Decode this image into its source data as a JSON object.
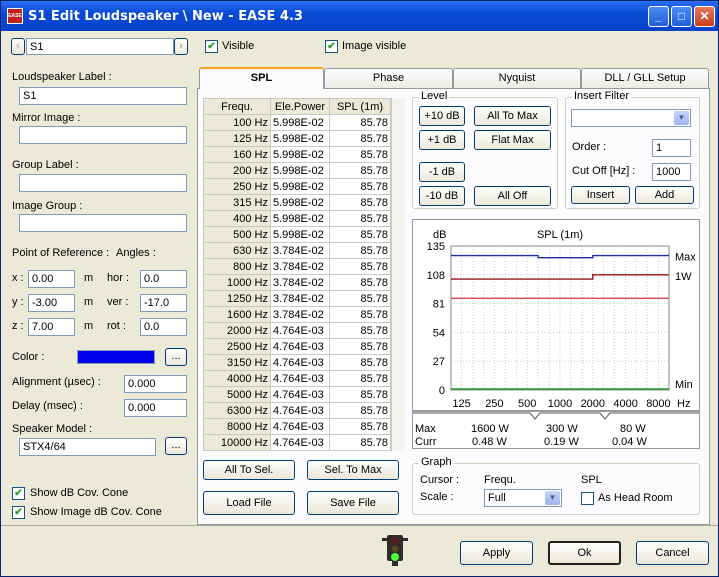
{
  "window": {
    "title": "S1 Edit Loudspeaker \\ New - EASE 4.3",
    "icon_text": "EASE",
    "buttons": {
      "minimize": "_",
      "maximize": "□",
      "close": "✕"
    }
  },
  "topbar": {
    "prev": "‹",
    "next": "›",
    "selector_value": "S1",
    "visible_label": "Visible",
    "visible_checked": true,
    "image_visible_label": "Image visible",
    "image_visible_checked": true
  },
  "left": {
    "loudspeaker_label_caption": "Loudspeaker Label :",
    "loudspeaker_label_value": "S1",
    "mirror_image_caption": "Mirror Image :",
    "mirror_image_value": "",
    "group_label_caption": "Group Label :",
    "group_label_value": "",
    "image_group_caption": "Image Group :",
    "image_group_value": "",
    "por_caption": "Point of Reference :",
    "angles_caption": "Angles :",
    "x_label": "x :",
    "x_value": "0.00",
    "x_unit": "m",
    "y_label": "y :",
    "y_value": "-3.00",
    "y_unit": "m",
    "z_label": "z :",
    "z_value": "7.00",
    "z_unit": "m",
    "hor_label": "hor :",
    "hor_value": "0.0",
    "ver_label": "ver :",
    "ver_value": "-17.0",
    "rot_label": "rot :",
    "rot_value": "0.0",
    "color_caption": "Color :",
    "color_value": "#0000ee",
    "ellipsis": "...",
    "alignment_caption": "Alignment (µsec) :",
    "alignment_value": "0.000",
    "delay_caption": "Delay (msec) :",
    "delay_value": "0.000",
    "speaker_model_caption": "Speaker Model :",
    "speaker_model_value": "STX4/64",
    "show_db_cov_label": "Show dB Cov. Cone",
    "show_db_cov_checked": true,
    "show_image_db_cov_label": "Show Image dB Cov. Cone",
    "show_image_db_cov_checked": true
  },
  "tabs": [
    "SPL",
    "Phase",
    "Nyquist",
    "DLL / GLL Setup"
  ],
  "table": {
    "headers": [
      "Frequ.",
      "Ele.Power",
      "SPL (1m)"
    ],
    "rows": [
      [
        "100 Hz",
        "5.998E-02",
        "85.78"
      ],
      [
        "125 Hz",
        "5.998E-02",
        "85.78"
      ],
      [
        "160 Hz",
        "5.998E-02",
        "85.78"
      ],
      [
        "200 Hz",
        "5.998E-02",
        "85.78"
      ],
      [
        "250 Hz",
        "5.998E-02",
        "85.78"
      ],
      [
        "315 Hz",
        "5.998E-02",
        "85.78"
      ],
      [
        "400 Hz",
        "5.998E-02",
        "85.78"
      ],
      [
        "500 Hz",
        "5.998E-02",
        "85.78"
      ],
      [
        "630 Hz",
        "3.784E-02",
        "85.78"
      ],
      [
        "800 Hz",
        "3.784E-02",
        "85.78"
      ],
      [
        "1000 Hz",
        "3.784E-02",
        "85.78"
      ],
      [
        "1250 Hz",
        "3.784E-02",
        "85.78"
      ],
      [
        "1600 Hz",
        "3.784E-02",
        "85.78"
      ],
      [
        "2000 Hz",
        "4.764E-03",
        "85.78"
      ],
      [
        "2500 Hz",
        "4.764E-03",
        "85.78"
      ],
      [
        "3150 Hz",
        "4.764E-03",
        "85.78"
      ],
      [
        "4000 Hz",
        "4.764E-03",
        "85.78"
      ],
      [
        "5000 Hz",
        "4.764E-03",
        "85.78"
      ],
      [
        "6300 Hz",
        "4.764E-03",
        "85.78"
      ],
      [
        "8000 Hz",
        "4.764E-03",
        "85.78"
      ],
      [
        "10000 Hz",
        "4.764E-03",
        "85.78"
      ]
    ],
    "all_to_sel": "All To Sel.",
    "sel_to_max": "Sel. To Max",
    "load_file": "Load File",
    "save_file": "Save File"
  },
  "level": {
    "title": "Level",
    "plus10": "+10 dB",
    "plus1": "+1 dB",
    "minus1": "-1 dB",
    "minus10": "-10 dB",
    "all_to_max": "All To Max",
    "flat_max": "Flat Max",
    "all_off": "All Off"
  },
  "insert_filter": {
    "title": "Insert Filter",
    "type_value": "",
    "order_label": "Order :",
    "order_value": "1",
    "cutoff_label": "Cut Off [Hz] :",
    "cutoff_value": "1000",
    "insert": "Insert",
    "add": "Add"
  },
  "chart_data": {
    "type": "line",
    "title": "SPL (1m)",
    "ylabel": "dB",
    "xlabel": "Hz",
    "ylim": [
      0,
      135
    ],
    "yticks": [
      0,
      27,
      54,
      81,
      108,
      135
    ],
    "xtick_labels": [
      "125",
      "250",
      "500",
      "1000",
      "2000",
      "4000",
      "8000"
    ],
    "right_labels": {
      "max": "Max",
      "w1": "1W",
      "min": "Min"
    },
    "x": [
      100,
      125,
      160,
      200,
      250,
      315,
      400,
      500,
      630,
      800,
      1000,
      1250,
      1600,
      2000,
      2500,
      3150,
      4000,
      5000,
      6300,
      8000,
      10000
    ],
    "series": [
      {
        "color": "#1c2fa8",
        "values": [
          126,
          126,
          126,
          126,
          126,
          126,
          126,
          126,
          124,
          124,
          124,
          124,
          124,
          126,
          126,
          126,
          126,
          126,
          126,
          126,
          126
        ]
      },
      {
        "color": "#9a1414",
        "values": [
          104,
          104,
          104,
          104,
          104,
          104,
          104,
          104,
          104,
          104,
          104,
          104,
          104,
          108,
          108,
          108,
          108,
          108,
          108,
          108,
          108
        ]
      },
      {
        "color": "#d24a4a",
        "values": [
          86,
          86,
          86,
          86,
          86,
          86,
          86,
          86,
          86,
          86,
          86,
          86,
          86,
          86,
          86,
          86,
          86,
          86,
          86,
          86,
          86
        ]
      },
      {
        "color": "#1b9a2a",
        "values": [
          1,
          1,
          1,
          1,
          1,
          1,
          1,
          1,
          1,
          1,
          1,
          1,
          1,
          1,
          1,
          1,
          1,
          1,
          1,
          1,
          1
        ]
      }
    ]
  },
  "info": {
    "max_label": "Max",
    "curr_label": "Curr",
    "cols": [
      {
        "max": "1600 W",
        "curr": "0.48 W"
      },
      {
        "max": "300 W",
        "curr": "0.19 W"
      },
      {
        "max": "80 W",
        "curr": "0.04 W"
      }
    ]
  },
  "graph": {
    "title": "Graph",
    "cursor_label": "Cursor :",
    "cursor_value": "Frequ.",
    "spl_label": "SPL",
    "scale_label": "Scale :",
    "scale_value": "Full",
    "head_room_label": "As Head Room",
    "head_room_checked": false
  },
  "footer": {
    "apply": "Apply",
    "ok": "Ok",
    "cancel": "Cancel"
  }
}
